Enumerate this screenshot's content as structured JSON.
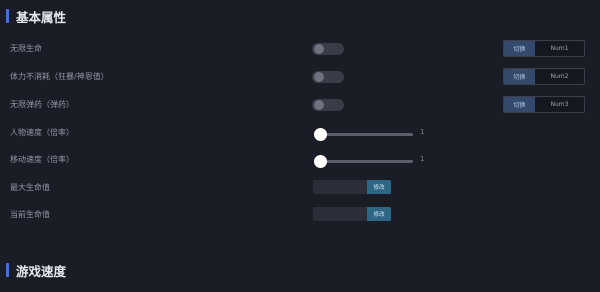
{
  "sections": [
    {
      "title": "基本属性"
    },
    {
      "title": "游戏速度"
    }
  ],
  "rows": {
    "r1": {
      "label": "无限生命",
      "toggle_on": false,
      "hotkey": {
        "k1": "切换",
        "k2": "Num1"
      }
    },
    "r2": {
      "label": "体力不消耗（狂暴/神恩值）",
      "toggle_on": false,
      "hotkey": {
        "k1": "切换",
        "k2": "Num2"
      }
    },
    "r3": {
      "label": "无限弹药（弹药）",
      "toggle_on": false,
      "hotkey": {
        "k1": "切换",
        "k2": "Num3"
      }
    },
    "r4": {
      "label": "人物速度（倍率）",
      "slider_value": "1"
    },
    "r5": {
      "label": "移动速度（倍率）",
      "slider_value": "1"
    },
    "r6": {
      "label": "最大生命值",
      "button": "修改"
    },
    "r7": {
      "label": "当前生命值",
      "button": "修改"
    }
  }
}
